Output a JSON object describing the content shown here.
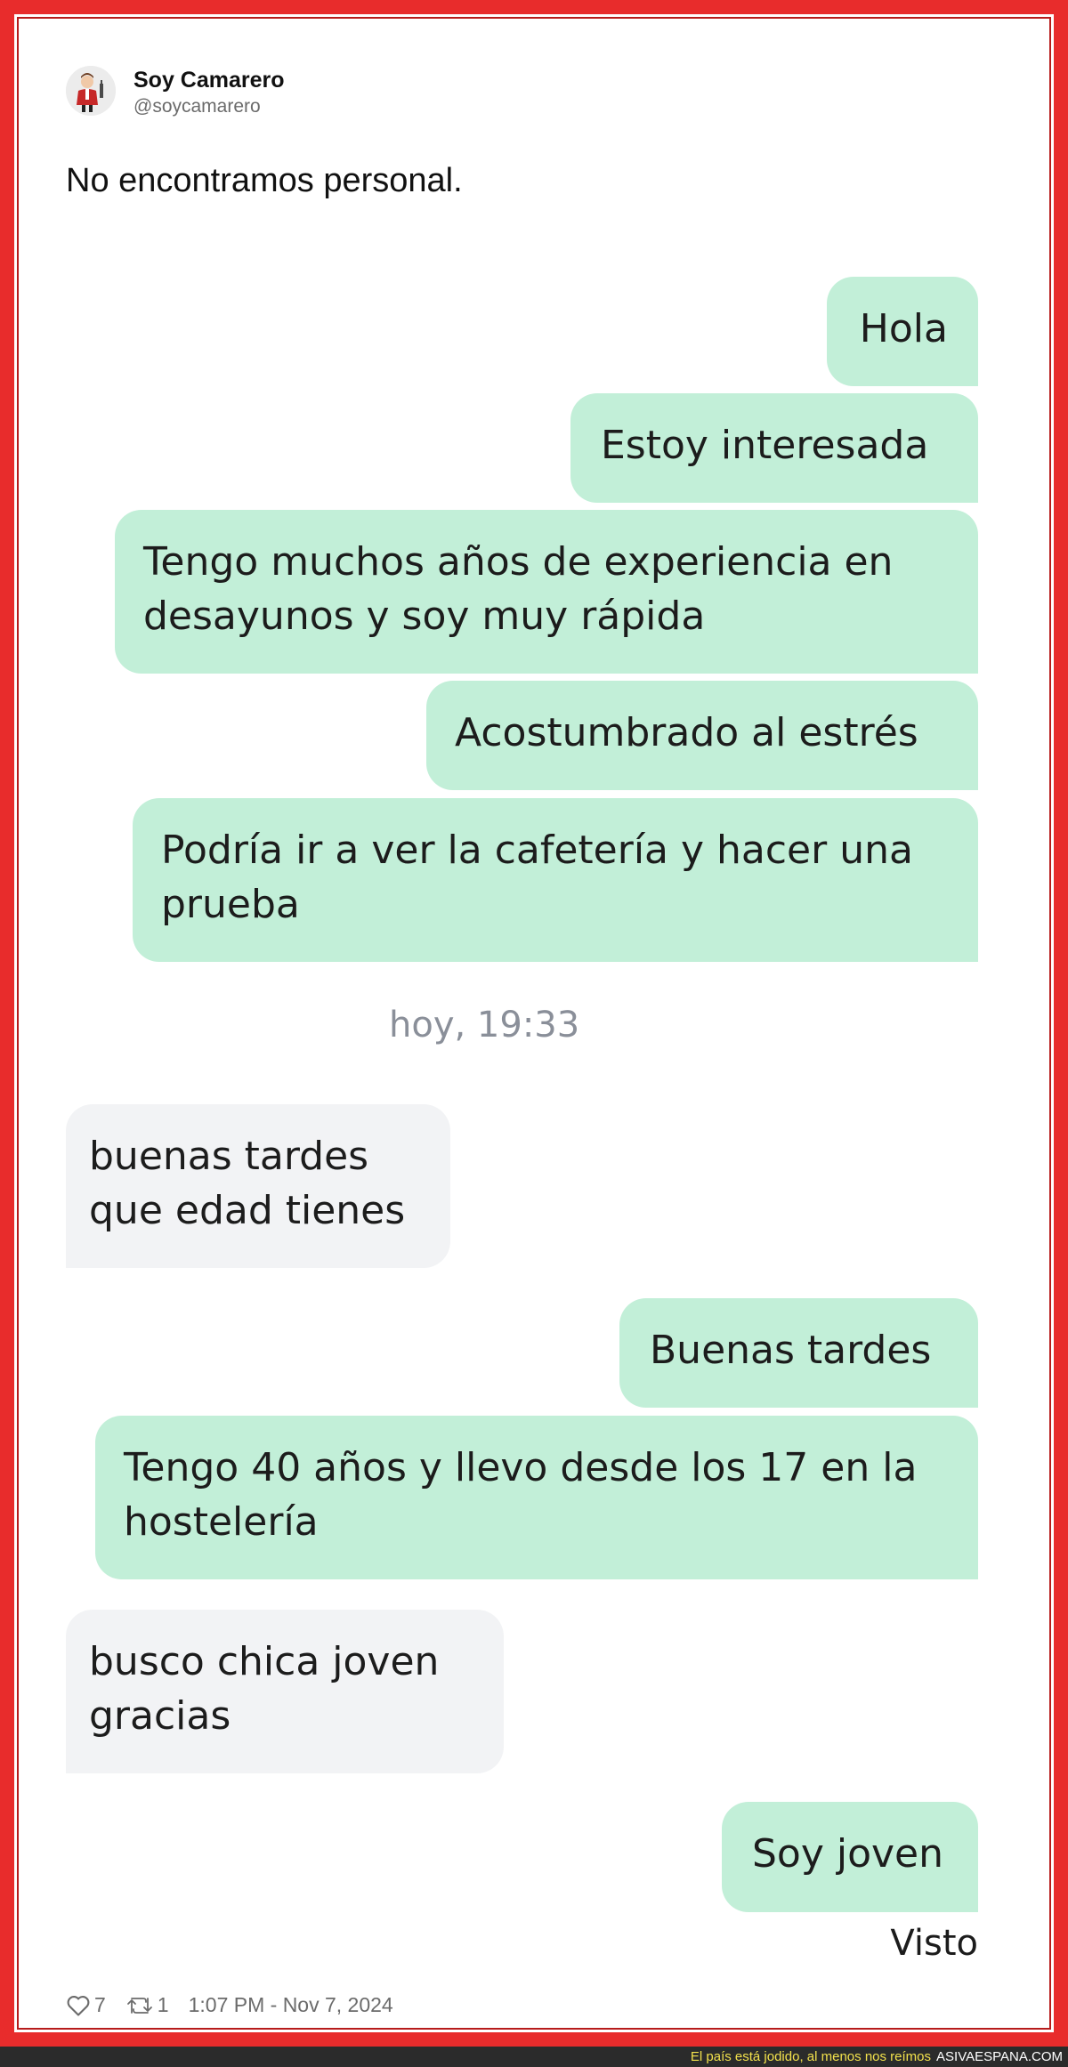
{
  "tweet": {
    "display_name": "Soy Camarero",
    "handle": "@soycamarero",
    "text": "No encontramos personal.",
    "likes": "7",
    "retweets": "1",
    "timestamp": "1:07 PM - Nov 7, 2024"
  },
  "chat": {
    "messages": [
      {
        "side": "outgoing",
        "text": "Hola"
      },
      {
        "side": "outgoing",
        "text": "Estoy interesada"
      },
      {
        "side": "outgoing",
        "text": "Tengo muchos años de experiencia en desayunos y soy muy rápida"
      },
      {
        "side": "outgoing",
        "text": "Acostumbrado al estrés"
      },
      {
        "side": "outgoing",
        "text": "Podría ir a ver la cafetería y hacer una prueba"
      },
      {
        "side": "incoming",
        "text": "buenas tardes que edad tienes"
      },
      {
        "side": "outgoing",
        "text": "Buenas tardes"
      },
      {
        "side": "outgoing",
        "text": "Tengo 40 años y llevo desde los 17 en la hostelería"
      },
      {
        "side": "incoming",
        "text": "busco chica joven gracias"
      },
      {
        "side": "outgoing",
        "text": "Soy joven"
      }
    ],
    "time_separator": "hoy, 19:33",
    "seen_label": "Visto"
  },
  "watermark": {
    "caption": "El país está jodido, al menos nos reímos",
    "brand": "ASIVAESPANA.COM"
  },
  "colors": {
    "frame": "#e82c2c",
    "outgoing_bubble": "#c2efd8",
    "incoming_bubble": "#f2f3f5",
    "watermark_caption": "#f2e14c"
  },
  "icons": {
    "like": "heart-icon",
    "retweet": "retweet-icon"
  }
}
